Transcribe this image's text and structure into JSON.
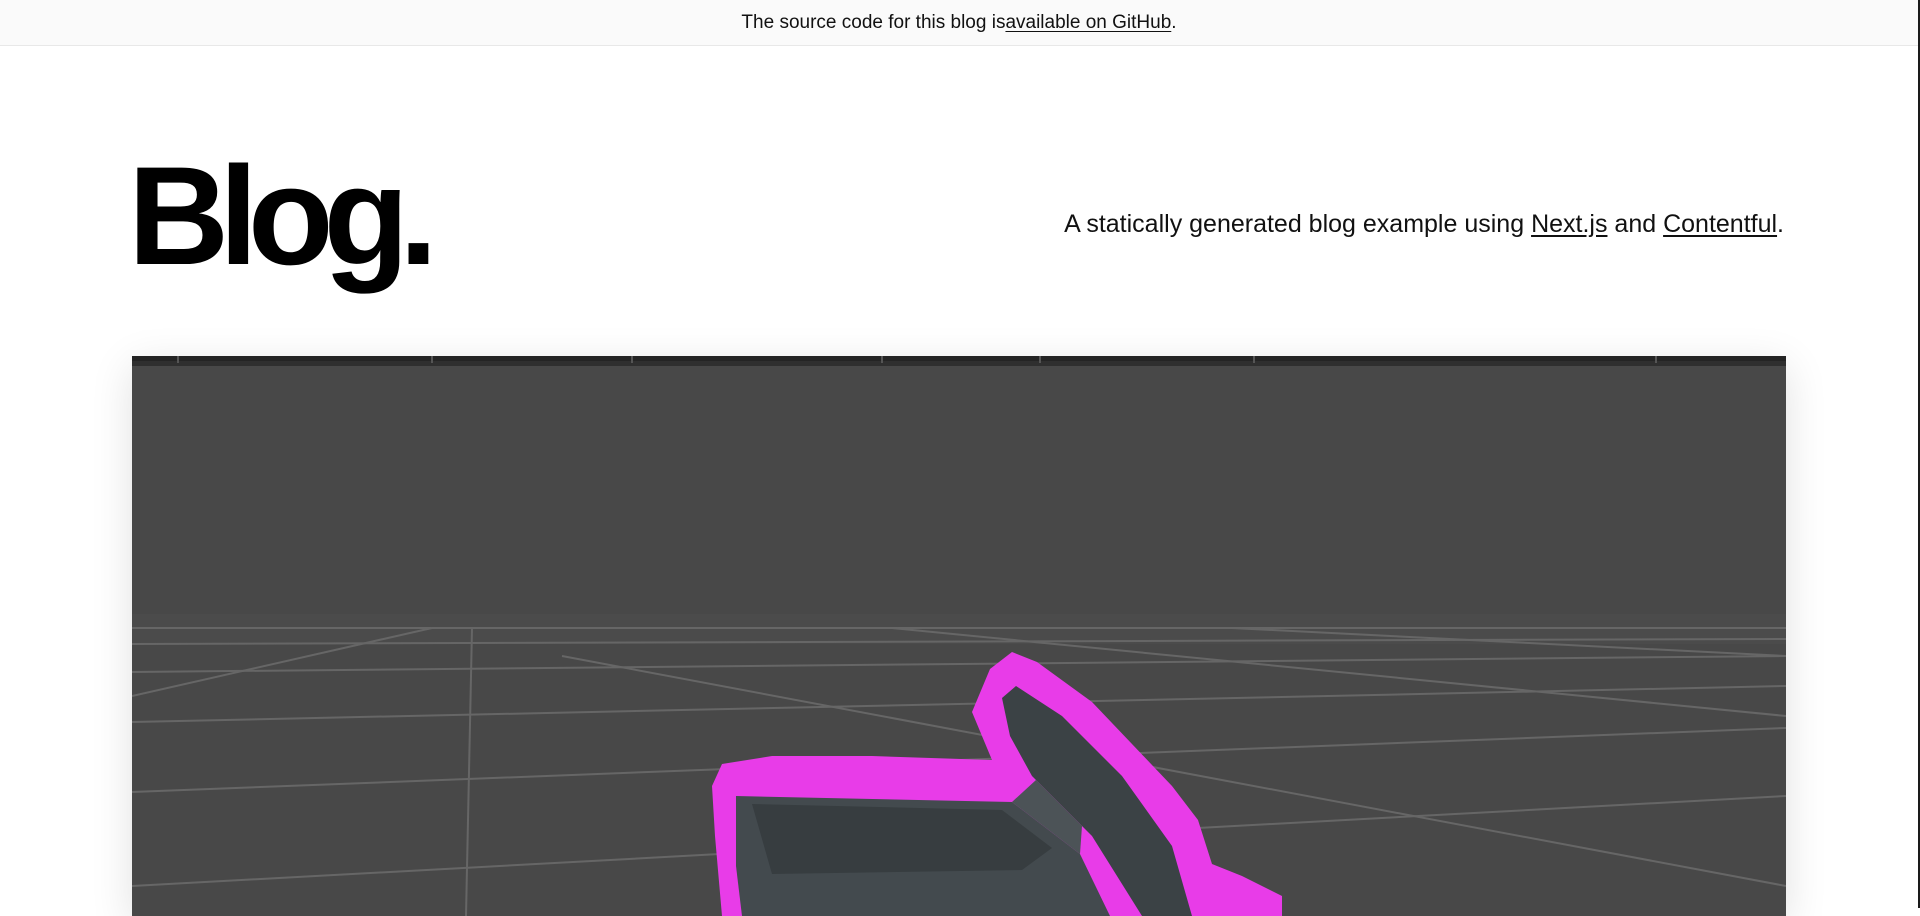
{
  "banner": {
    "text_before": "The source code for this blog is ",
    "link_label": "available on GitHub",
    "text_after": "."
  },
  "header": {
    "title": "Blog.",
    "intro_before": "A statically generated blog example using ",
    "nextjs_link": "Next.js",
    "intro_middle": " and ",
    "contentful_link": "Contentful",
    "intro_after": "."
  },
  "hero": {
    "kind": "3d-render-preview",
    "colors": {
      "background": "#484848",
      "grid": "#6a6a6a",
      "object": "#3f4649",
      "highlight": "#e83ce8"
    }
  }
}
